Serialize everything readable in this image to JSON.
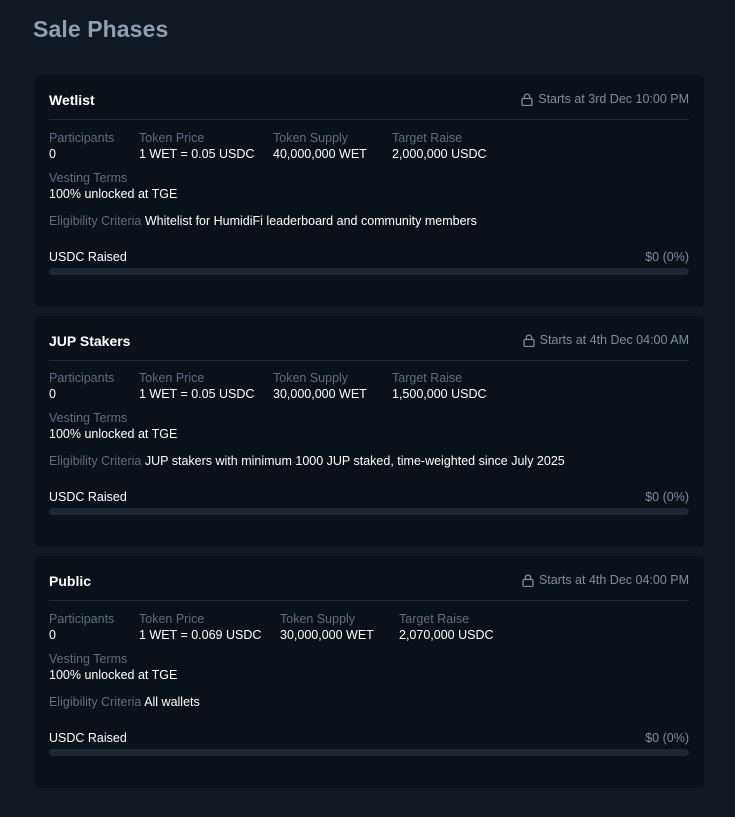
{
  "page": {
    "title": "Sale Phases"
  },
  "phases": [
    {
      "name": "Wetlist",
      "start": "Starts at 3rd Dec 10:00 PM",
      "participants_label": "Participants",
      "participants": "0",
      "price_label": "Token Price",
      "price": "1 WET = 0.05 USDC",
      "supply_label": "Token Supply",
      "supply": "40,000,000 WET",
      "raise_label": "Target Raise",
      "raise": "2,000,000 USDC",
      "vesting_label": "Vesting Terms",
      "vesting": "100% unlocked at TGE",
      "eligibility_label": "Eligibility Criteria",
      "eligibility": "Whitelist for HumidiFi leaderboard and community members",
      "raised_label": "USDC Raised",
      "raised_value": "$0 (0%)",
      "progress": 0
    },
    {
      "name": "JUP Stakers",
      "start": "Starts at 4th Dec 04:00 AM",
      "participants_label": "Participants",
      "participants": "0",
      "price_label": "Token Price",
      "price": "1 WET = 0.05 USDC",
      "supply_label": "Token Supply",
      "supply": "30,000,000 WET",
      "raise_label": "Target Raise",
      "raise": "1,500,000 USDC",
      "vesting_label": "Vesting Terms",
      "vesting": "100% unlocked at TGE",
      "eligibility_label": "Eligibility Criteria",
      "eligibility": "JUP stakers with minimum 1000 JUP staked, time-weighted since July 2025",
      "raised_label": "USDC Raised",
      "raised_value": "$0 (0%)",
      "progress": 0
    },
    {
      "name": "Public",
      "start": "Starts at 4th Dec 04:00 PM",
      "participants_label": "Participants",
      "participants": "0",
      "price_label": "Token Price",
      "price": "1 WET = 0.069 USDC",
      "supply_label": "Token Supply",
      "supply": "30,000,000 WET",
      "raise_label": "Target Raise",
      "raise": "2,070,000 USDC",
      "vesting_label": "Vesting Terms",
      "vesting": "100% unlocked at TGE",
      "eligibility_label": "Eligibility Criteria",
      "eligibility": "All wallets",
      "raised_label": "USDC Raised",
      "raised_value": "$0 (0%)",
      "progress": 0
    }
  ],
  "icons": {
    "start_time": "lock-icon"
  },
  "colors": {
    "background": "#111821",
    "card": "#0b1119",
    "title": "#8e9fb3",
    "muted_label": "#5f6e80",
    "progress_track": "#1e2731"
  }
}
